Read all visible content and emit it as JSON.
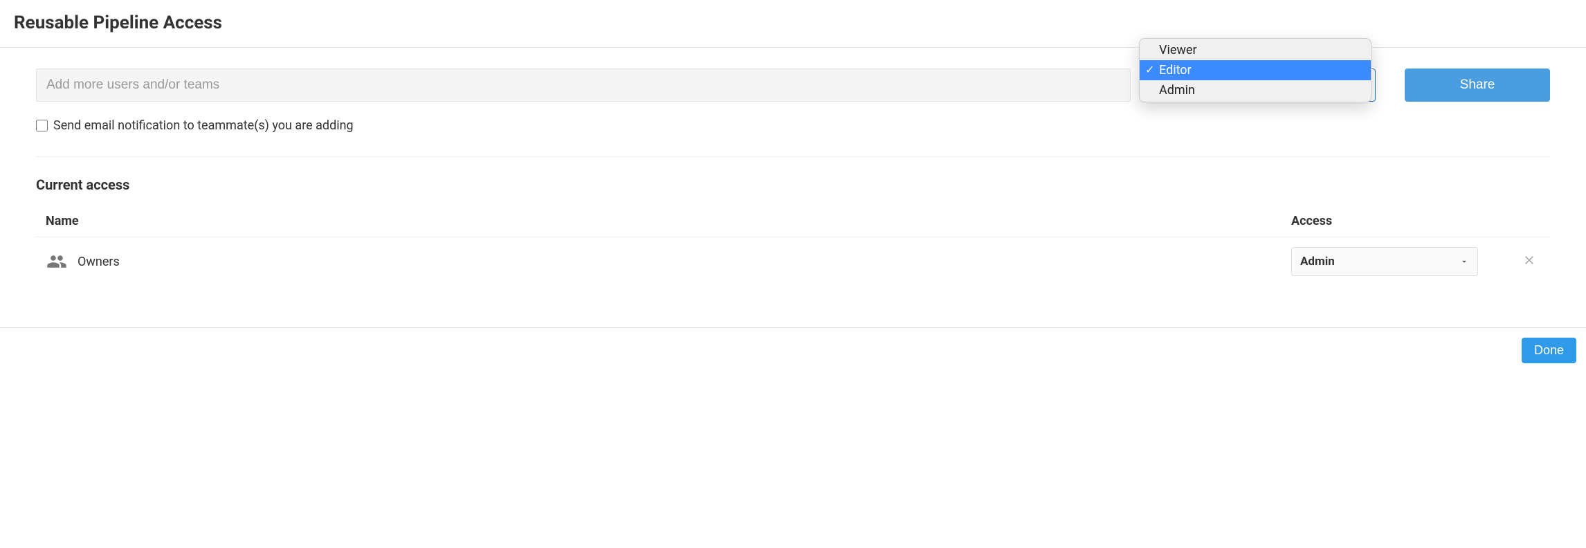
{
  "header": {
    "title": "Reusable Pipeline Access"
  },
  "add": {
    "placeholder": "Add more users and/or teams",
    "role_options": [
      "Viewer",
      "Editor",
      "Admin"
    ],
    "role_selected": "Editor",
    "share_label": "Share",
    "notify_label": "Send email notification to teammate(s) you are adding",
    "notify_checked": false
  },
  "current": {
    "heading": "Current access",
    "columns": {
      "name": "Name",
      "access": "Access"
    },
    "rows": [
      {
        "name": "Owners",
        "access": "Admin"
      }
    ]
  },
  "footer": {
    "done_label": "Done"
  }
}
